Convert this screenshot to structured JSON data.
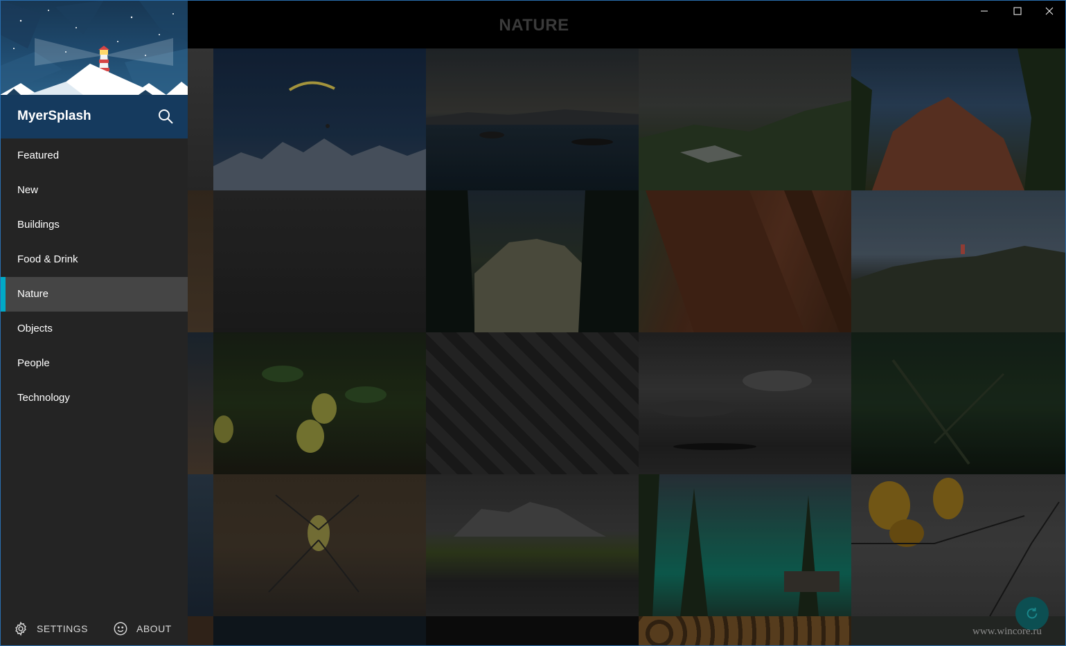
{
  "app": {
    "title": "MyerSplash"
  },
  "header": {
    "title": "NATURE"
  },
  "nav": {
    "items": [
      {
        "label": "Featured"
      },
      {
        "label": "New"
      },
      {
        "label": "Buildings"
      },
      {
        "label": "Food & Drink"
      },
      {
        "label": "Nature",
        "active": true
      },
      {
        "label": "Objects"
      },
      {
        "label": "People"
      },
      {
        "label": "Technology"
      }
    ]
  },
  "footer": {
    "settings_label": "SETTINGS",
    "about_label": "ABOUT"
  },
  "window_controls": {
    "minimize_icon": "minimize-icon",
    "maximize_icon": "maximize-icon",
    "close_icon": "close-icon"
  },
  "watermark": "www.wincore.ru",
  "colors": {
    "accent": "#00a9c7",
    "app_bar": "#153a5e",
    "sidebar": "#242424",
    "active_item": "#454545"
  },
  "gallery": {
    "photos": [
      {
        "subject": "paraglider-over-mountains"
      },
      {
        "subject": "lake-at-dusk"
      },
      {
        "subject": "green-hills-snow"
      },
      {
        "subject": "red-rock-formation"
      },
      {
        "subject": "dark-sky"
      },
      {
        "subject": "mountain-forest"
      },
      {
        "subject": "wooden-plank"
      },
      {
        "subject": "lighthouse-on-rocks"
      },
      {
        "subject": "pears-on-branch"
      },
      {
        "subject": "dark-leaves"
      },
      {
        "subject": "stormy-clouds"
      },
      {
        "subject": "dark-forest"
      },
      {
        "subject": "spider"
      },
      {
        "subject": "mountain-reflection"
      },
      {
        "subject": "turquoise-lake"
      },
      {
        "subject": "yellow-leaves"
      }
    ]
  }
}
